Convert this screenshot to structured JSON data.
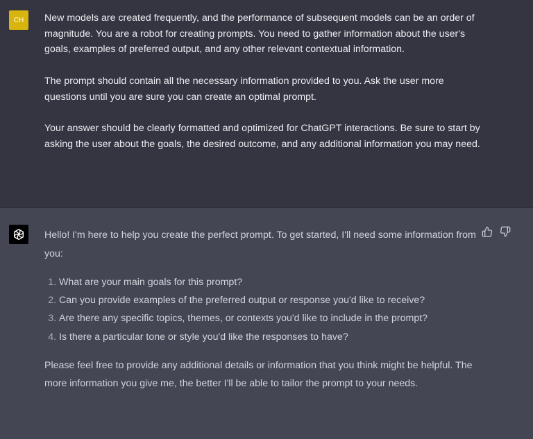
{
  "user_message": {
    "avatar_initials": "CH",
    "avatar_color": "#d8b40e",
    "paragraphs": [
      "New models are created frequently, and the performance of subsequent models can be an order of magnitude. You are a robot for creating prompts. You need to gather information about the user's goals, examples of preferred output, and any other relevant contextual information.",
      "The prompt should contain all the necessary information provided to you. Ask the user more questions until you are sure you can create an optimal prompt.",
      "Your answer should be clearly formatted and optimized for ChatGPT interactions. Be sure to start by asking the user about the goals, the desired outcome, and any additional information you may need."
    ]
  },
  "assistant_message": {
    "avatar_icon": "openai-logo-icon",
    "intro": "Hello! I'm here to help you create the perfect prompt. To get started, I'll need some information from you:",
    "questions": [
      "What are your main goals for this prompt?",
      "Can you provide examples of the preferred output or response you'd like to receive?",
      "Are there any specific topics, themes, or contexts you'd like to include in the prompt?",
      "Is there a particular tone or style you'd like the responses to have?"
    ],
    "closing": "Please feel free to provide any additional details or information that you think might be helpful. The more information you give me, the better I'll be able to tailor the prompt to your needs.",
    "feedback_icons": [
      "thumbs-up-icon",
      "thumbs-down-icon"
    ]
  },
  "colors": {
    "user_bg": "#343541",
    "assistant_bg": "#444654",
    "text": "#ececf1"
  }
}
